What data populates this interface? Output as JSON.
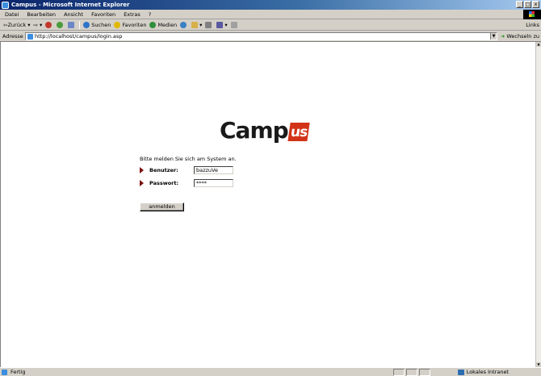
{
  "window": {
    "title": "Campus - Microsoft Internet Explorer",
    "controls": [
      "_",
      "□",
      "x"
    ]
  },
  "menu": {
    "items": [
      {
        "label": "Datei"
      },
      {
        "label": "Bearbeiten"
      },
      {
        "label": "Ansicht"
      },
      {
        "label": "Favoriten"
      },
      {
        "label": "Extras"
      },
      {
        "label": "?"
      }
    ]
  },
  "toolbar": {
    "back": "Zurück",
    "search": "Suchen",
    "favorites": "Favoriten",
    "media": "Medien",
    "links": "Links"
  },
  "address": {
    "label": "Adresse",
    "url": "http://localhost/campus/login.asp",
    "go": "Wechseln zu"
  },
  "page": {
    "logo_text": "Camp",
    "logo_badge": "us",
    "prompt": "Bitte melden Sie sich am System an.",
    "username_label": "Benutzer:",
    "username_value": "bazzuVe",
    "password_label": "Passwort:",
    "password_value": "****",
    "submit_label": "anmelden"
  },
  "status": {
    "text": "Fertig",
    "zone": "Lokales Intranet"
  },
  "colors": {
    "titlebar": "#0a246a",
    "badge": "#d23318",
    "bullet": "#7a1010",
    "chrome": "#d4d0c8"
  }
}
